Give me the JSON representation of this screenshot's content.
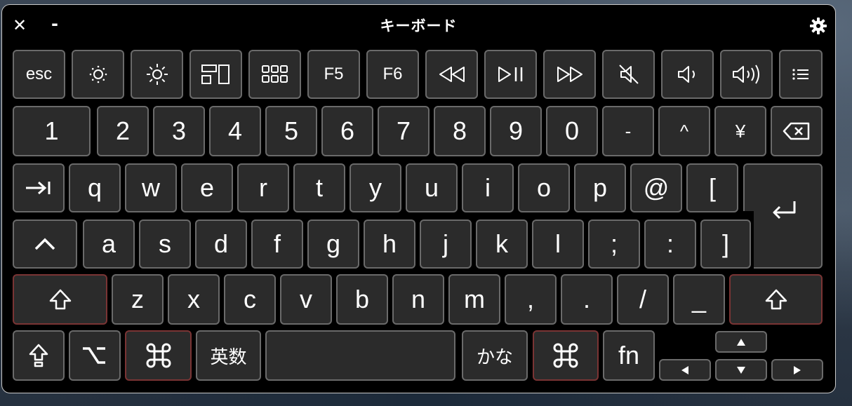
{
  "window": {
    "title": "キーボード",
    "close": "✕",
    "minimize": "-"
  },
  "icons": {
    "gear": "gear-icon"
  },
  "function_row": {
    "esc": "esc",
    "f5": "F5",
    "f6": "F6"
  },
  "number_row": [
    "1",
    "2",
    "3",
    "4",
    "5",
    "6",
    "7",
    "8",
    "9",
    "0",
    "-",
    "^",
    "¥"
  ],
  "qwerty_row": [
    "q",
    "w",
    "e",
    "r",
    "t",
    "y",
    "u",
    "i",
    "o",
    "p",
    "@",
    "["
  ],
  "home_row": [
    "a",
    "s",
    "d",
    "f",
    "g",
    "h",
    "j",
    "k",
    "l",
    ";",
    ":",
    "]"
  ],
  "shift_row": [
    "z",
    "x",
    "c",
    "v",
    "b",
    "n",
    "m",
    ",",
    ".",
    "/",
    "_"
  ],
  "bottom_row": {
    "eisu": "英数",
    "kana": "かな",
    "fn": "fn"
  },
  "colors": {
    "key_bg": "#2b2b2b",
    "key_border": "#6a6a6a",
    "modifier_border": "#7a3434"
  }
}
